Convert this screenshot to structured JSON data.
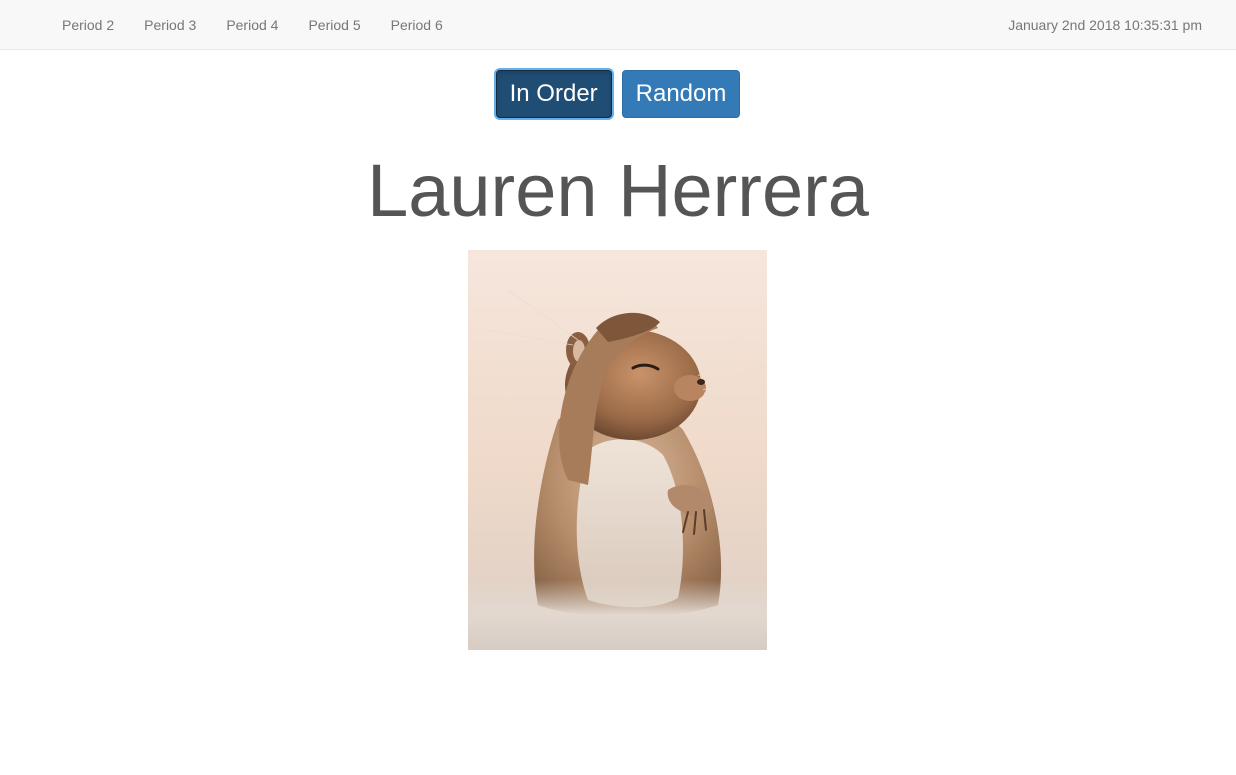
{
  "navbar": {
    "links": [
      {
        "label": "Period 2"
      },
      {
        "label": "Period 3"
      },
      {
        "label": "Period 4"
      },
      {
        "label": "Period 5"
      },
      {
        "label": "Period 6"
      }
    ],
    "datetime": "January 2nd 2018 10:35:31 pm"
  },
  "controls": {
    "in_order_label": "In Order",
    "random_label": "Random",
    "selected": "In Order"
  },
  "student": {
    "name": "Lauren Herrera",
    "photo_subject": "ground squirrel"
  },
  "colors": {
    "primary": "#337ab7",
    "primary_active": "#204d74",
    "navbar_bg": "#f8f8f8",
    "text_muted": "#777777",
    "name_text": "#555555"
  }
}
